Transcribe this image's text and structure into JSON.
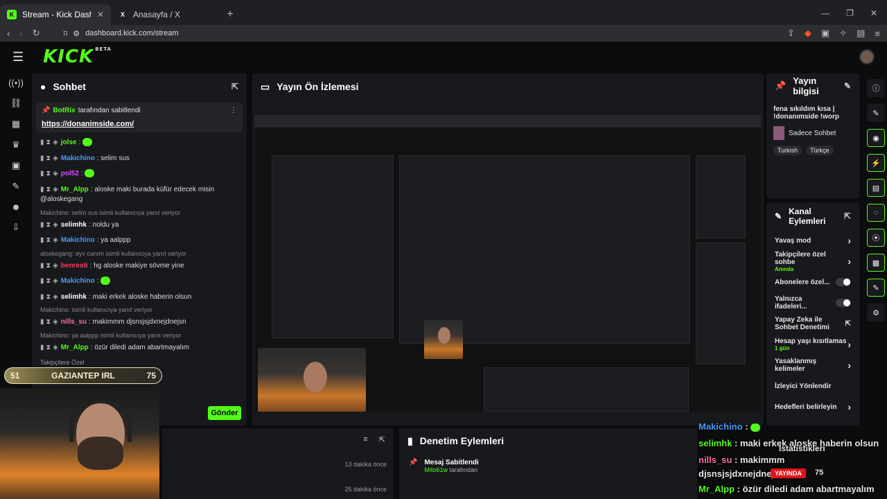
{
  "browser": {
    "tabs": [
      {
        "title": "Stream - Kick Dashboard",
        "active": true
      },
      {
        "title": "Anasayfa / X",
        "active": false
      }
    ],
    "url": "dashboard.kick.com/stream"
  },
  "app": {
    "logo": "KICK",
    "beta": "BETA"
  },
  "chat": {
    "title": "Sohbet",
    "pinned": {
      "by": "BotRix",
      "by_suffix": "tarafından sabitlendi",
      "link": "https://donanimside.com/"
    },
    "lines": [
      {
        "user": "jolse",
        "color": "#53fc18",
        "text": ""
      },
      {
        "user": "Makichino",
        "color": "#4a9bff",
        "text": "selim sus"
      },
      {
        "user": "pol52",
        "color": "#d24dff",
        "text": ""
      },
      {
        "user": "Mr_Alpp",
        "color": "#53fc18",
        "text": "aloske maki burada küfür edecek misin @aloskegang"
      },
      {
        "reply": "Makichino: selim sus isimli kullanıcıya yanıt veriyor"
      },
      {
        "user": "selimhk",
        "color": "#ffffff",
        "text": "noldu ya"
      },
      {
        "user": "Makichino",
        "color": "#4a9bff",
        "text": "ya aalppp"
      },
      {
        "reply": "aloskegang: eyv canım isimli kullanıcıya yanıt veriyor"
      },
      {
        "user": "benresti",
        "color": "#ff3b5c",
        "text": "hg aloske makiye sövme yine"
      },
      {
        "user": "Makichino",
        "color": "#4a9bff",
        "text": ""
      },
      {
        "user": "selimhk",
        "color": "#ffffff",
        "text": "maki erkek aloske haberin olsun"
      },
      {
        "reply": "Makichino: isimli kullanıcıya yanıt veriyor"
      },
      {
        "user": "nills_su",
        "color": "#ff6fa0",
        "text": "makimmm djsnsjsjdxnejdnejsn"
      },
      {
        "reply": "Makichino: ya aalppp isimli kullanıcıya yanıt veriyor"
      },
      {
        "user": "Mr_Alpp",
        "color": "#53fc18",
        "text": "özür diledi adam abartmayalım"
      }
    ],
    "followers_only": "Takipçilere Özel",
    "send_label": "Gönder"
  },
  "preview": {
    "title": "Yayın Ön İzlemesi"
  },
  "stream_info": {
    "title": "Yayın bilgisi",
    "stream_title": "fena sıkıldım kısa | !donanımside !worp",
    "category": "Sadece Sohbet",
    "tags": [
      "Turkish",
      "Türkçe"
    ]
  },
  "channel_actions": {
    "title": "Kanal Eylemleri",
    "items": [
      {
        "label": "Yavaş mod",
        "type": "arrow"
      },
      {
        "label": "Takipçilere özel sohbe",
        "sub": "Anında",
        "type": "arrow"
      },
      {
        "label": "Abonelere özel...",
        "type": "toggle"
      },
      {
        "label": "Yalnızca ifadeleri...",
        "type": "toggle"
      },
      {
        "label": "Yapay Zeka ile Sohbet Denetimi",
        "type": "ext"
      },
      {
        "label": "Hesap yaşı kısıtlamas",
        "sub": "1 gün",
        "type": "arrow"
      },
      {
        "label": "Yasaklanmış kelimeler",
        "type": "arrow"
      },
      {
        "label": "İzleyici Yönlendir",
        "type": "none"
      },
      {
        "label": "Hedefleri belirleyin",
        "type": "arrow"
      }
    ]
  },
  "activity": {
    "rows": [
      {
        "time": "13 dakika önce"
      },
      {
        "time": "25 dakika önce"
      }
    ]
  },
  "moderation": {
    "title": "Denetim Eylemleri",
    "item_title": "Mesaj Sabitlendi",
    "item_by": "Mito61w",
    "item_by_suffix": "tarafından"
  },
  "overlay": {
    "bar_left": "51",
    "bar_text": "GAZIANTEP IRL",
    "bar_right": "75",
    "chat": [
      {
        "user": "Makichino",
        "text": "",
        "color": "#4a9bff"
      },
      {
        "user": "selimhk",
        "text": "maki erkek aloske haberin olsun",
        "color": "#53fc18"
      },
      {
        "user": "nills_su",
        "text": "makimmm",
        "color": "#ff6fa0"
      },
      {
        "user": "",
        "text": "djsnsjsjdxnejdnejsn",
        "color": "#ffffff"
      },
      {
        "user": "Mr_Alpp",
        "text": "özür diledi adam abartmayalım",
        "color": "#53fc18"
      }
    ],
    "stats": "İstatistikleri",
    "live": "YAYINDA",
    "viewers": "75"
  }
}
